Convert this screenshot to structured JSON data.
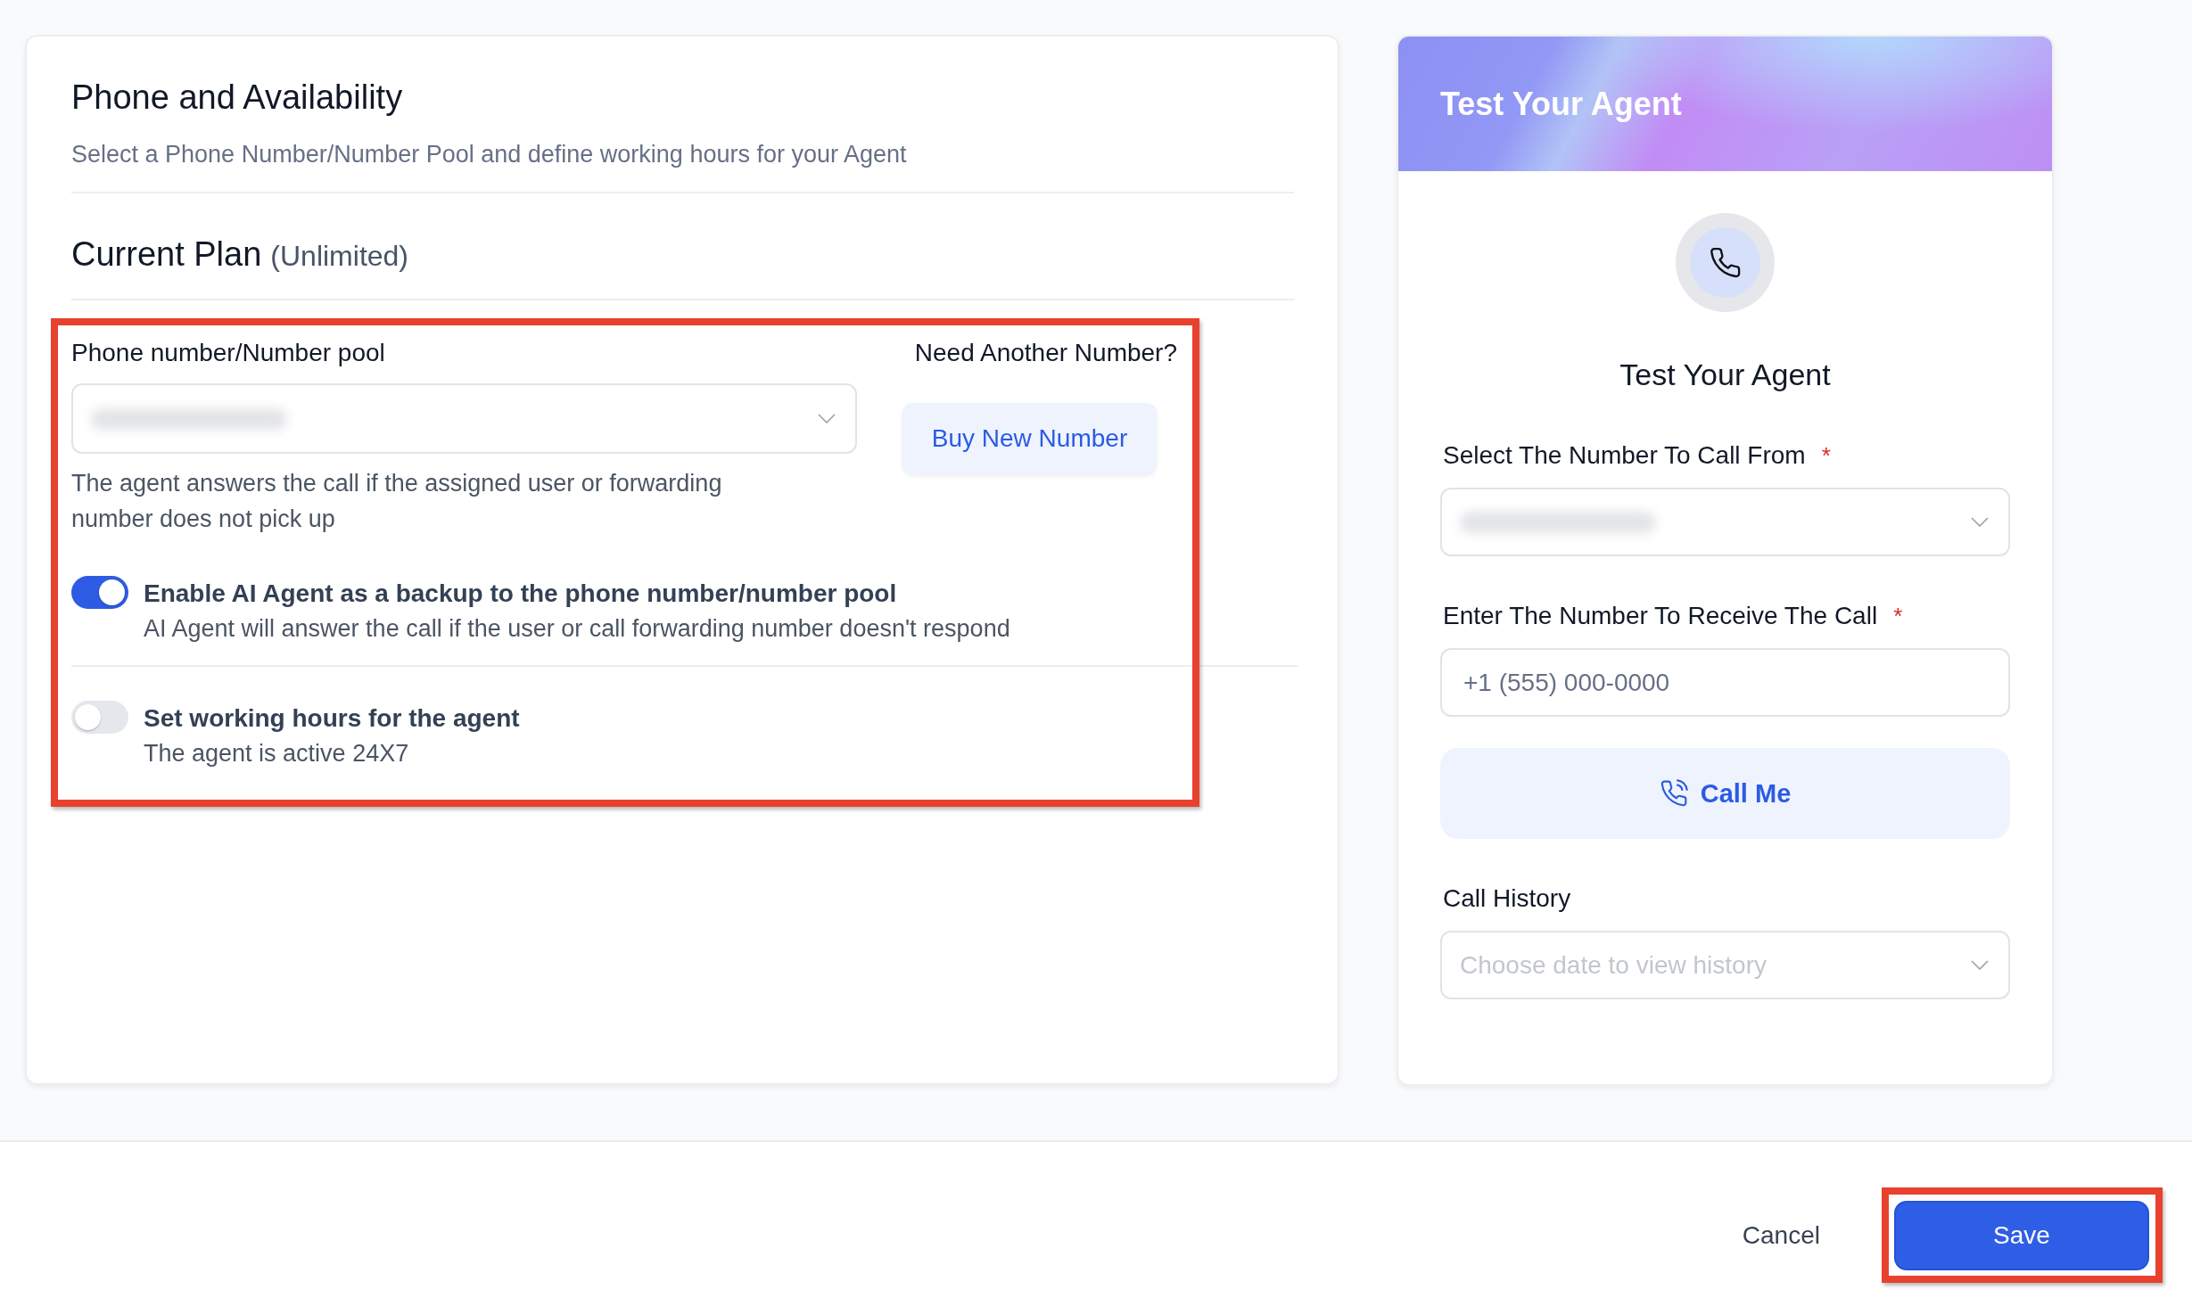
{
  "phone_availability": {
    "title": "Phone and Availability",
    "subtitle": "Select a Phone Number/Number Pool and define working hours for your Agent",
    "plan": {
      "label": "Current Plan",
      "value": "(Unlimited)"
    },
    "phone_section": {
      "highlighted": true,
      "field_label": "Phone number/Number pool",
      "number_select": {
        "value_redacted": true
      },
      "helper_text": "The agent answers the call if the assigned user or forwarding number does not pick up",
      "aside_label": "Need Another Number?",
      "aside_button": "Buy New Number"
    },
    "toggles": [
      {
        "label": "Enable AI Agent as a backup to the phone number/number pool",
        "description": "AI Agent will answer the call if the user or call forwarding number doesn't respond",
        "on": true
      },
      {
        "label": "Set working hours for the agent",
        "description": "The agent is active 24X7",
        "on": false
      }
    ]
  },
  "test_agent": {
    "header_title": "Test Your Agent",
    "title": "Test Your Agent",
    "caller_select": {
      "label": "Select The Number To Call From",
      "required_mark": "*",
      "value_redacted": true
    },
    "receiver_input": {
      "label": "Enter The Number To Receive The Call",
      "required_mark": "*",
      "placeholder": "+1 (555) 000-0000"
    },
    "call_button": "Call Me",
    "history_select": {
      "label": "Call History",
      "placeholder": "Choose date to view history"
    }
  },
  "footer": {
    "buttons": [
      {
        "label": "Cancel",
        "kind": "secondary",
        "highlighted": false
      },
      {
        "label": "Save",
        "kind": "primary",
        "highlighted": true
      }
    ]
  }
}
